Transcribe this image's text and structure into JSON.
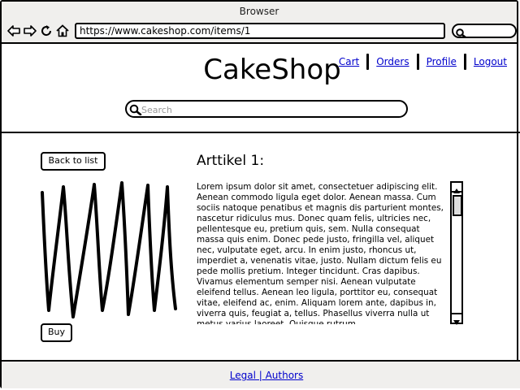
{
  "window": {
    "title": "Browser"
  },
  "browser": {
    "url": "https://www.cakeshop.com/items/1",
    "nav_icons": [
      "back-arrow-icon",
      "forward-arrow-icon",
      "reload-icon",
      "home-icon"
    ],
    "search_icon": "search-icon"
  },
  "header": {
    "title": "CakeShop",
    "nav": [
      "Cart",
      "Orders",
      "Profile",
      "Logout"
    ],
    "search": {
      "placeholder": "Search",
      "value": ""
    }
  },
  "product": {
    "back_label": "Back to list",
    "buy_label": "Buy",
    "image_icon": "image-placeholder",
    "heading": "Arttikel 1:",
    "description": "Lorem ipsum dolor sit amet, consectetuer adipiscing elit. Aenean commodo ligula eget dolor. Aenean massa. Cum sociis natoque penatibus et magnis dis parturient montes, nascetur ridiculus mus. Donec quam felis, ultricies nec, pellentesque eu, pretium quis, sem. Nulla consequat massa quis enim. Donec pede justo, fringilla vel, aliquet nec, vulputate eget, arcu. In enim justo, rhoncus ut, imperdiet a, venenatis vitae, justo. Nullam dictum felis eu pede mollis pretium. Integer tincidunt. Cras dapibus. Vivamus elementum semper nisi. Aenean vulputate eleifend tellus. Aenean leo ligula, porttitor eu, consequat vitae, eleifend ac, enim. Aliquam lorem ante, dapibus in, viverra quis, feugiat a, tellus. Phasellus viverra nulla ut metus varius laoreet. Quisque rutrum."
  },
  "footer": {
    "link": "Legal | Authors"
  }
}
